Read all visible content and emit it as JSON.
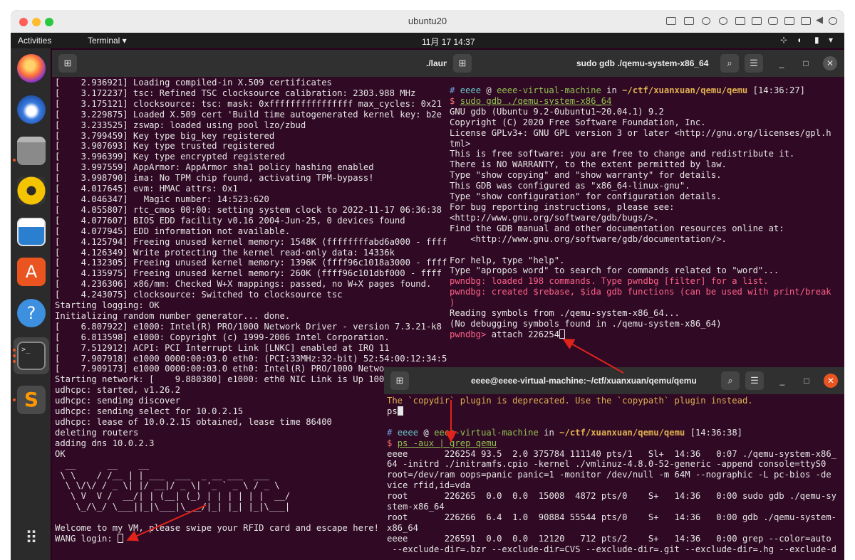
{
  "mac": {
    "title": "ubuntu20"
  },
  "topbar": {
    "activities": "Activities",
    "app_menu": "Terminal ▾",
    "clock": "11月 17  14:37"
  },
  "dock": {
    "items": [
      "firefox-icon",
      "thunderbird-icon",
      "files-icon",
      "rhythmbox-icon",
      "writer-icon",
      "software-icon",
      "help-icon",
      "terminal-icon",
      "sublime-icon"
    ]
  },
  "left_terminal": {
    "title": "./laun",
    "lines": [
      "[    2.936921] Loading compiled-in X.509 certificates",
      "[    3.172237] tsc: Refined TSC clocksource calibration: 2303.988 MHz",
      "[    3.175121] clocksource: tsc: mask: 0xffffffffffffffff max_cycles: 0x21",
      "[    3.229875] Loaded X.509 cert 'Build time autogenerated kernel key: b2e",
      "[    3.233525] zswap: loaded using pool lzo/zbud",
      "[    3.799459] Key type big_key registered",
      "[    3.907693] Key type trusted registered",
      "[    3.996399] Key type encrypted registered",
      "[    3.997559] AppArmor: AppArmor sha1 policy hashing enabled",
      "[    3.998790] ima: No TPM chip found, activating TPM-bypass!",
      "[    4.017645] evm: HMAC attrs: 0x1",
      "[    4.046347]   Magic number: 14:523:620",
      "[    4.055807] rtc_cmos 00:00: setting system clock to 2022-11-17 06:36:38",
      "[    4.077607] BIOS EDD facility v0.16 2004-Jun-25, 0 devices found",
      "[    4.077945] EDD information not available.",
      "[    4.125794] Freeing unused kernel memory: 1548K (ffffffffabd6a000 - ffff",
      "[    4.126349] Write protecting the kernel read-only data: 14336k",
      "[    4.132305] Freeing unused kernel memory: 1396K (ffff96c1018a3000 - ffff",
      "[    4.135975] Freeing unused kernel memory: 260K (ffff96c101dbf000 - ffff",
      "[    4.236306] x86/mm: Checked W+X mappings: passed, no W+X pages found.",
      "[    4.243075] clocksource: Switched to clocksource tsc",
      "Starting logging: OK",
      "Initializing random number generator... done.",
      "[    6.807922] e1000: Intel(R) PRO/1000 Network Driver - version 7.3.21-k8",
      "[    6.813598] e1000: Copyright (c) 1999-2006 Intel Corporation.",
      "[    7.512912] ACPI: PCI Interrupt Link [LNKC] enabled at IRQ 11",
      "[    7.907918] e1000 0000:00:03.0 eth0: (PCI:33MHz:32-bit) 52:54:00:12:34:5",
      "[    7.909173] e1000 0000:00:03.0 eth0: Intel(R) PRO/1000 Netwo",
      "Starting network: [    9.880380] e1000: eth0 NIC Link is Up 100",
      "udhcpc: started, v1.26.2",
      "udhcpc: sending discover",
      "udhcpc: sending select for 10.0.2.15",
      "udhcpc: lease of 10.0.2.15 obtained, lease time 86400",
      "deleting routers",
      "adding dns 10.0.2.3",
      "OK",
      "  __      __    __                   ",
      " \\ \\    / /__ | | ___  ___  _ __ ___  ___ ",
      "  \\ \\/\\/ / _ \\| |/ __|/ _ \\| '_ ` _ \\ / _ \\",
      "   \\ V  V /  __/| | (__| (_) | | | | | |  __/",
      "    \\_/\\_/ \\___||_|\\___|\\___/|_| |_| |_|\\___|",
      "",
      "Welcome to my VM, please swipe your RFID card and escape here!",
      "WANG login: "
    ]
  },
  "gdb_terminal": {
    "title": "sudo gdb ./qemu-system-x86_64",
    "prompt_hash": "# ",
    "prompt_user": "eeee",
    "prompt_at": " @ ",
    "prompt_host": "eeee-virtual-machine",
    "prompt_in": " in ",
    "prompt_path": "~/ctf/xuanxuan/qemu/qemu",
    "prompt_time": " [14:36:27]",
    "cmd_dollar": "$ ",
    "cmd": "sudo gdb ./qemu-system-x86_64",
    "lines": [
      "GNU gdb (Ubuntu 9.2-0ubuntu1~20.04.1) 9.2",
      "Copyright (C) 2020 Free Software Foundation, Inc.",
      "License GPLv3+: GNU GPL version 3 or later <http://gnu.org/licenses/gpl.h",
      "tml>",
      "This is free software: you are free to change and redistribute it.",
      "There is NO WARRANTY, to the extent permitted by law.",
      "Type \"show copying\" and \"show warranty\" for details.",
      "This GDB was configured as \"x86_64-linux-gnu\".",
      "Type \"show configuration\" for configuration details.",
      "For bug reporting instructions, please see:",
      "<http://www.gnu.org/software/gdb/bugs/>.",
      "Find the GDB manual and other documentation resources online at:",
      "    <http://www.gnu.org/software/gdb/documentation/>.",
      "",
      "For help, type \"help\".",
      "Type \"apropos word\" to search for commands related to \"word\"..."
    ],
    "pwndbg_loaded": "pwndbg: loaded 198 commands. Type pwndbg [filter] for a list.",
    "pwndbg_created": "pwndbg: created $rebase, $ida gdb functions (can be used with print/break",
    "paren": ")",
    "reading": "Reading symbols from ./qemu-system-x86_64...",
    "nodebug": "(No debugging symbols found in ./qemu-system-x86_64)",
    "attach_prompt": "pwndbg> ",
    "attach_cmd": "attach 226254"
  },
  "ps_terminal": {
    "title": "eeee@eeee-virtual-machine:~/ctf/xuanxuan/qemu/qemu",
    "deprecated": "The `copydir` plugin is deprecated. Use the `copypath` plugin instead.",
    "ps_line": "ps",
    "prompt_hash": "# ",
    "prompt_user": "eeee",
    "prompt_at": " @ ",
    "prompt_host": "eeee-virtual-machine",
    "prompt_in": " in ",
    "prompt_path": "~/ctf/xuanxuan/qemu/qemu",
    "prompt_time": " [14:36:38]",
    "cmd_dollar": "$ ",
    "cmd": "ps -aux | grep qemu",
    "lines": [
      "eeee       226254 93.5  2.0 375784 111140 pts/1   Sl+  14:36   0:07 ./qemu-system-x86_",
      "64 -initrd ./initramfs.cpio -kernel ./vmlinuz-4.8.0-52-generic -append console=ttyS0",
      "root=/dev/ram oops=panic panic=1 -monitor /dev/null -m 64M --nographic -L pc-bios -de",
      "vice rfid,id=vda",
      "root       226265  0.0  0.0  15008  4872 pts/0    S+   14:36   0:00 sudo gdb ./qemu-sy",
      "stem-x86_64",
      "root       226266  6.4  1.0  90884 55544 pts/0    S+   14:36   0:00 gdb ./qemu-system-",
      "x86_64",
      "eeee       226591  0.0  0.0  12120   712 pts/2    S+   14:36   0:00 grep --color=auto",
      " --exclude-dir=.bzr --exclude-dir=CVS --exclude-dir=.git --exclude-dir=.hg --exclude-d"
    ]
  }
}
